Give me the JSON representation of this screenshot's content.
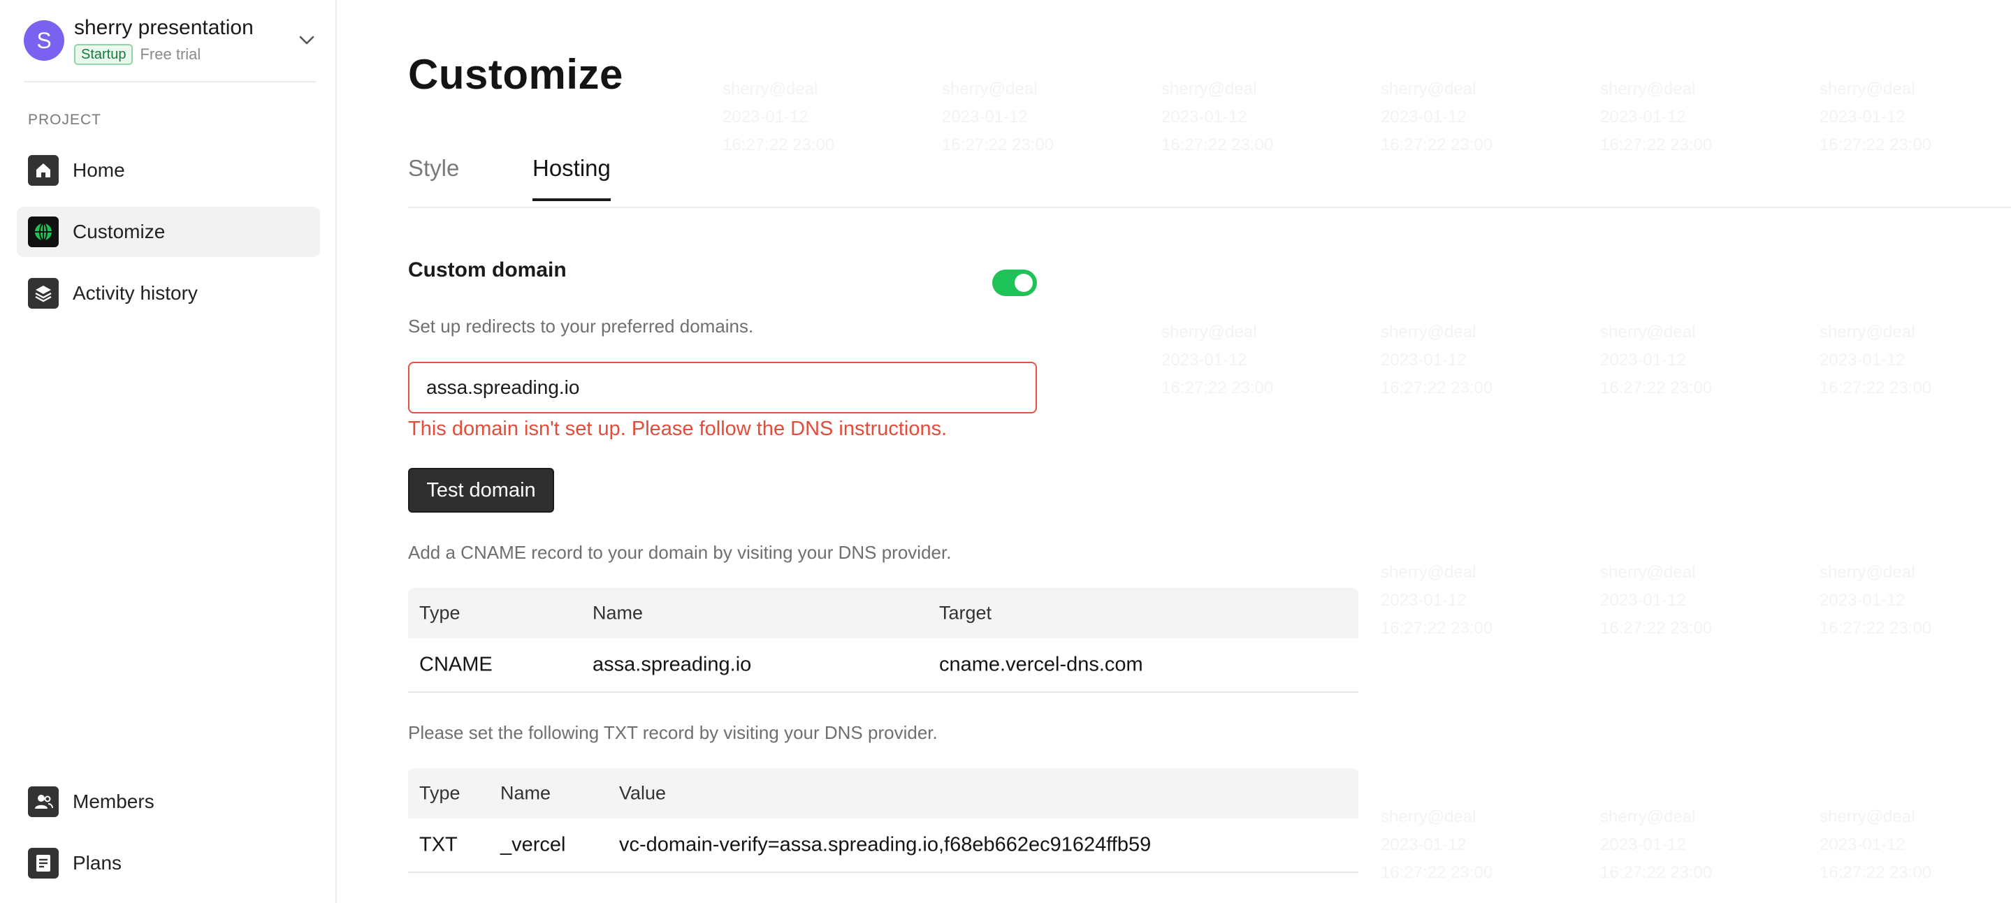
{
  "sidebar": {
    "workspace": {
      "initial": "S",
      "name": "sherry presentation",
      "plan_badge": "Startup",
      "trial": "Free trial"
    },
    "section_label": "PROJECT",
    "items": [
      {
        "label": "Home",
        "icon": "home-icon"
      },
      {
        "label": "Customize",
        "icon": "globe-icon",
        "active": true
      },
      {
        "label": "Activity history",
        "icon": "layers-icon"
      }
    ],
    "bottom_items": [
      {
        "label": "Members",
        "icon": "members-icon"
      },
      {
        "label": "Plans",
        "icon": "plans-icon"
      }
    ]
  },
  "main": {
    "title": "Customize",
    "tabs": [
      {
        "label": "Style",
        "active": false
      },
      {
        "label": "Hosting",
        "active": true
      }
    ],
    "custom_domain": {
      "heading": "Custom domain",
      "enabled": true,
      "description": "Set up redirects to your preferred domains.",
      "input_value": "assa.spreading.io",
      "error": "This domain isn't set up. Please follow the DNS instructions.",
      "test_button": "Test domain"
    },
    "cname": {
      "intro": "Add a CNAME record to your domain by visiting your DNS provider.",
      "headers": [
        "Type",
        "Name",
        "Target"
      ],
      "row": [
        "CNAME",
        "assa.spreading.io",
        "cname.vercel-dns.com"
      ]
    },
    "txt": {
      "intro": "Please set the following TXT record by visiting your DNS provider.",
      "headers": [
        "Type",
        "Name",
        "Value"
      ],
      "row": [
        "TXT",
        "_vercel",
        "vc-domain-verify=assa.spreading.io,f68eb662ec91624ffb59"
      ]
    }
  },
  "colors": {
    "accent": "#7b61f0",
    "toggle_on": "#1fc256",
    "error": "#e34c3a",
    "button": "#2f2f2f"
  }
}
